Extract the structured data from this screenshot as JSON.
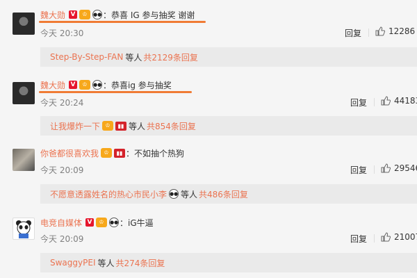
{
  "comments": [
    {
      "user": "魏大勋",
      "text": "：恭喜 IG 参与抽奖 谢谢",
      "time": "今天 20:30",
      "reply_label": "回复",
      "likes": "12286",
      "sub_user": "Step-By-Step-FAN",
      "sub_mid": "等人",
      "sub_total": "共2129条回复"
    },
    {
      "user": "魏大勋",
      "text": "：恭喜ig 参与抽奖",
      "time": "今天 20:24",
      "reply_label": "回复",
      "likes": "44183",
      "sub_user": "让我爆炸一下",
      "sub_mid": "等人",
      "sub_total": "共854条回复"
    },
    {
      "user": "你爸都很喜欢我",
      "text": "：不如抽个热狗",
      "time": "今天 20:09",
      "reply_label": "回复",
      "likes": "29546",
      "sub_user": "不愿意透露姓名的热心市民小李",
      "sub_mid": "等人",
      "sub_total": "共486条回复"
    },
    {
      "user": "电竞自媒体",
      "text": "：iG牛逼",
      "time": "今天 20:09",
      "reply_label": "回复",
      "likes": "21007",
      "sub_user": "SwaggyPEI",
      "sub_mid": "等人",
      "sub_total": "共274条回复"
    }
  ],
  "colors": {
    "username": "#eb7350",
    "highlight_underline": "#f07b34",
    "reply_box": "#eaeaea"
  },
  "icons": {
    "like": "thumbs-up-icon",
    "verified": "verified-badge-icon",
    "vip": "vip-badge-icon",
    "panda": "panda-emoji-icon"
  }
}
